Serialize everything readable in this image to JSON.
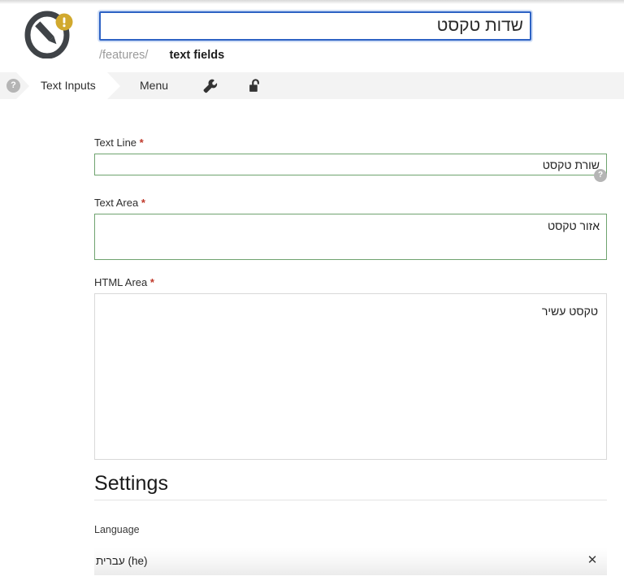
{
  "app": {
    "logo_icon": "pencil-in-circle-logo",
    "badge_icon": "warning-exclamation-badge"
  },
  "header": {
    "title_value": "שדות טקסט",
    "title_placeholder": "",
    "breadcrumb_path": "/features/",
    "breadcrumb_current": "text fields"
  },
  "tabbar": {
    "help_label": "?",
    "tabs": [
      {
        "label": "Text Inputs",
        "active": true
      },
      {
        "label": "Menu",
        "active": false
      }
    ],
    "icons": [
      {
        "name": "wrench-icon"
      },
      {
        "name": "unlock-icon"
      }
    ]
  },
  "form": {
    "fields": [
      {
        "label": "Text Line",
        "required_mark": "*",
        "value": "שורת טקסט",
        "help_label": "?"
      },
      {
        "label": "Text Area",
        "required_mark": "*",
        "value": "אזור טקסט"
      },
      {
        "label": "HTML Area",
        "required_mark": "*",
        "value": "טקסט עשיר"
      }
    ]
  },
  "settings": {
    "heading": "Settings",
    "language_label": "Language",
    "language_value": "עברית (he)",
    "clear_label": "✕"
  },
  "colors": {
    "focus_border": "#2d62c4",
    "field_border_green": "#6fa36f",
    "field_border_gray": "#d9d9d9",
    "required_red": "#c0392b",
    "badge_gold": "#d1a92e",
    "logo_dark": "#3f4347",
    "tabbar_bg": "#f3f3f3",
    "help_gray": "#b5b5b5"
  }
}
